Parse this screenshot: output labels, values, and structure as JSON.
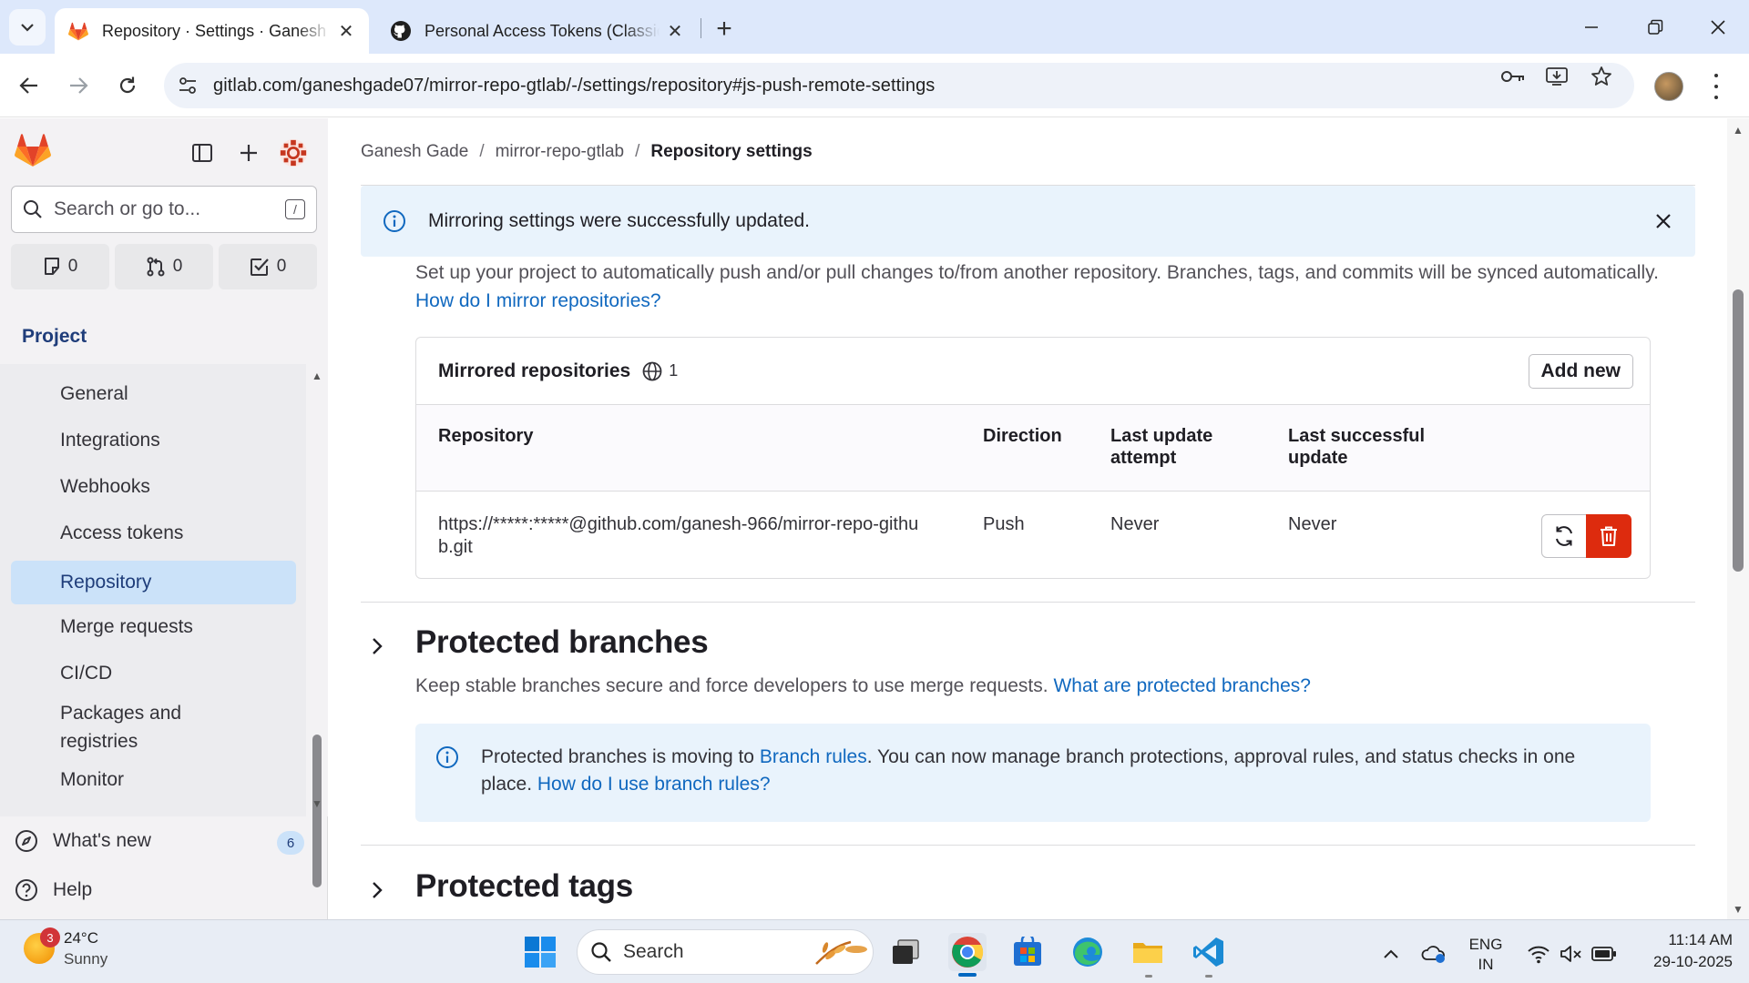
{
  "browser": {
    "tabs": [
      {
        "title": "Repository · Settings · Ganesh G",
        "favicon": "gitlab-icon",
        "active": true
      },
      {
        "title": "Personal Access Tokens (Classic",
        "favicon": "github-icon",
        "active": false
      }
    ],
    "url": "gitlab.com/ganeshgade07/mirror-repo-gtlab/-/settings/repository#js-push-remote-settings"
  },
  "sidebar": {
    "search_placeholder": "Search or go to...",
    "search_shortcut": "/",
    "counters": {
      "issues": "0",
      "merge_requests": "0",
      "todos": "0"
    },
    "context_label": "Project",
    "items": [
      {
        "label": "General",
        "active": false
      },
      {
        "label": "Integrations",
        "active": false
      },
      {
        "label": "Webhooks",
        "active": false
      },
      {
        "label": "Access tokens",
        "active": false
      },
      {
        "label": "Repository",
        "active": true
      },
      {
        "label": "Merge requests",
        "active": false
      },
      {
        "label": "CI/CD",
        "active": false
      },
      {
        "label": "Packages and registries",
        "active": false
      },
      {
        "label": "Monitor",
        "active": false
      }
    ],
    "whats_new": {
      "label": "What's new",
      "count": "6"
    },
    "help": {
      "label": "Help"
    }
  },
  "breadcrumb": {
    "items": [
      "Ganesh Gade",
      "mirror-repo-gtlab",
      "Repository settings"
    ]
  },
  "alert": {
    "message": "Mirroring settings were successfully updated."
  },
  "mirroring": {
    "intro": "Set up your project to automatically push and/or pull changes to/from another repository. Branches, tags, and commits will be synced automatically.",
    "intro_link": "How do I mirror repositories?",
    "card_title": "Mirrored repositories",
    "count": "1",
    "add_new": "Add new",
    "columns": [
      "Repository",
      "Direction",
      "Last update attempt",
      "Last successful update"
    ],
    "rows": [
      {
        "repository": "https://*****:*****@github.com/ganesh-966/mirror-repo-github.git",
        "direction": "Push",
        "last_attempt": "Never",
        "last_success": "Never"
      }
    ]
  },
  "protected_branches": {
    "title": "Protected branches",
    "description": "Keep stable branches secure and force developers to use merge requests.",
    "description_link": "What are protected branches?",
    "info_pre": "Protected branches is moving to ",
    "info_link1": "Branch rules",
    "info_mid": ". You can now manage branch protections, approval rules, and status checks in one place. ",
    "info_link2": "How do I use branch rules?"
  },
  "protected_tags": {
    "title": "Protected tags"
  },
  "taskbar": {
    "weather": {
      "temp": "24°C",
      "condition": "Sunny",
      "badge": "3"
    },
    "search_label": "Search",
    "language": {
      "line1": "ENG",
      "line2": "IN"
    },
    "time": "11:14 AM",
    "date": "29-10-2025"
  },
  "colors": {
    "gitlab_blue": "#1068bf",
    "danger": "#dd2b0e",
    "active_nav": "#cbe2f9",
    "alert_bg": "#e9f3fc"
  }
}
